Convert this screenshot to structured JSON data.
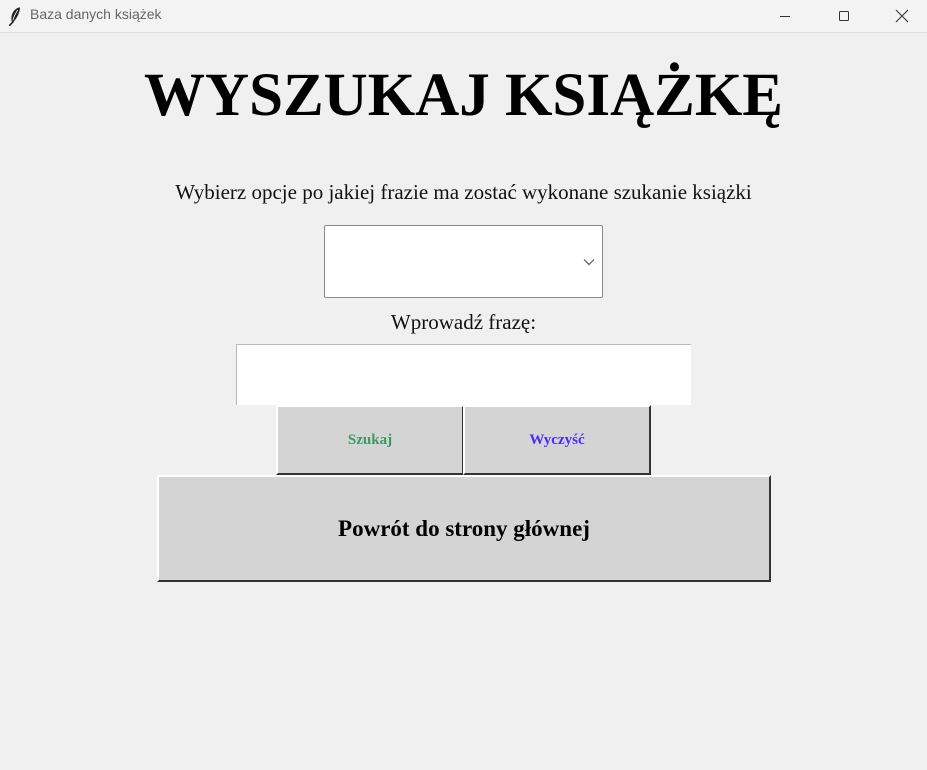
{
  "window": {
    "title": "Baza danych książek",
    "icon": "feather-icon",
    "controls": [
      "minimize-icon",
      "maximize-icon",
      "close-icon"
    ]
  },
  "page": {
    "heading": "WYSZUKAJ KSIĄŻKĘ",
    "instruction": "Wybierz opcje po jakiej frazie ma zostać wykonane szukanie książki",
    "search_option": {
      "value": "",
      "icon": "chevron-down-icon"
    },
    "phrase_label": "Wprowadź frazę:",
    "phrase_input": {
      "value": ""
    },
    "buttons": {
      "search": "Szukaj",
      "clear": "Wyczyść",
      "back": "Powrót do strony głównej"
    }
  },
  "colors": {
    "background": "#f0f0f0",
    "button_face": "#d4d4d4",
    "search_text": "#3b9a63",
    "clear_text": "#4b2cff"
  }
}
